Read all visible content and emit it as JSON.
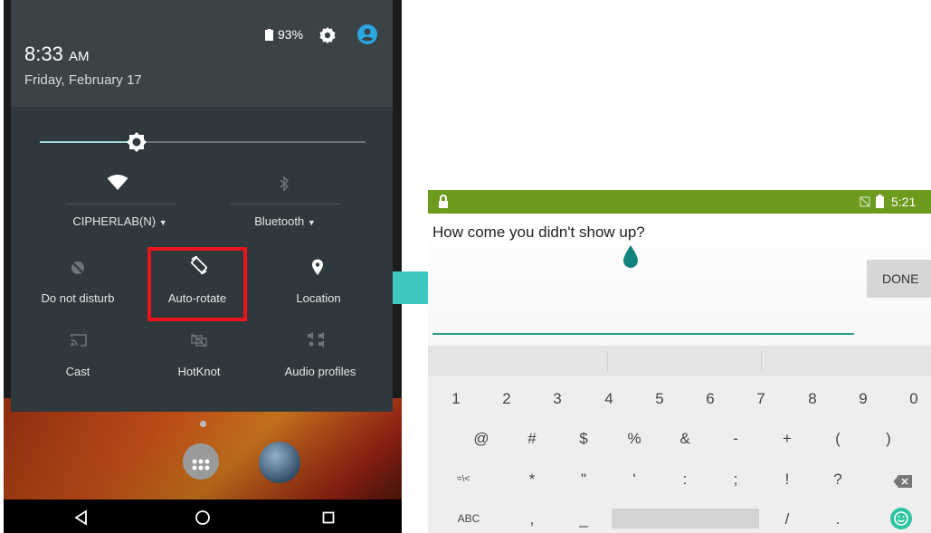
{
  "phone": {
    "status": {
      "battery": "93%"
    },
    "header": {
      "time": "8:33",
      "ampm": "AM",
      "date": "Friday, February 17"
    },
    "tiles_row1": [
      {
        "label": "CIPHERLAB(N)",
        "icon": "wifi-icon"
      },
      {
        "label": "Bluetooth",
        "icon": "bluetooth-icon"
      }
    ],
    "tiles_row2": [
      {
        "label": "Do not disturb",
        "icon": "do-not-disturb-icon"
      },
      {
        "label": "Auto-rotate",
        "icon": "auto-rotate-icon"
      },
      {
        "label": "Location",
        "icon": "location-icon"
      }
    ],
    "tiles_row3": [
      {
        "label": "Cast",
        "icon": "cast-icon"
      },
      {
        "label": "HotKnot",
        "icon": "hotknot-icon"
      },
      {
        "label": "Audio profiles",
        "icon": "audio-profiles-icon"
      }
    ],
    "highlight_color": "#e8141b"
  },
  "arrow_color": "#40c8c0",
  "tablet": {
    "status": {
      "time": "5:21"
    },
    "input_text": "How come you didn't show up?",
    "done_label": "DONE",
    "keyboard": {
      "row1": [
        "1",
        "2",
        "3",
        "4",
        "5",
        "6",
        "7",
        "8",
        "9",
        "0"
      ],
      "row2": [
        "@",
        "#",
        "$",
        "%",
        "&",
        "-",
        "+",
        "(",
        ")"
      ],
      "row3": [
        "=\\<",
        "*",
        "\"",
        "'",
        ":",
        ";",
        "!",
        "?"
      ],
      "row4": [
        "ABC",
        ",",
        "_",
        "/",
        "."
      ]
    },
    "accent_color": "#2a9d8f"
  }
}
